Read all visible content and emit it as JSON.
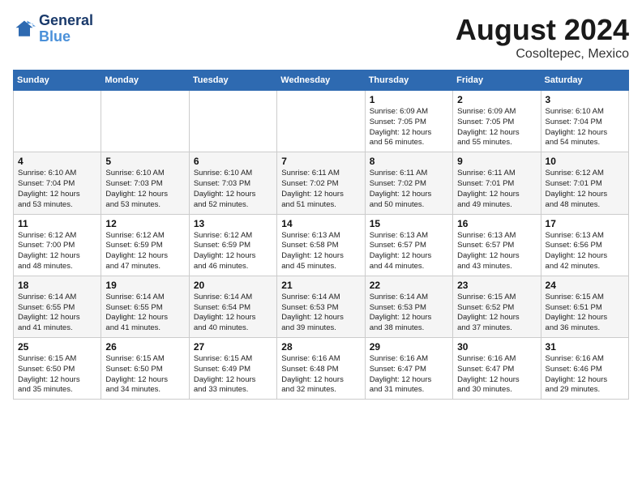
{
  "header": {
    "logo_line1": "General",
    "logo_line2": "Blue",
    "title": "August 2024",
    "subtitle": "Cosoltepec, Mexico"
  },
  "calendar": {
    "days_of_week": [
      "Sunday",
      "Monday",
      "Tuesday",
      "Wednesday",
      "Thursday",
      "Friday",
      "Saturday"
    ],
    "weeks": [
      {
        "days": [
          {
            "num": "",
            "info": ""
          },
          {
            "num": "",
            "info": ""
          },
          {
            "num": "",
            "info": ""
          },
          {
            "num": "",
            "info": ""
          },
          {
            "num": "1",
            "info": "Sunrise: 6:09 AM\nSunset: 7:05 PM\nDaylight: 12 hours\nand 56 minutes."
          },
          {
            "num": "2",
            "info": "Sunrise: 6:09 AM\nSunset: 7:05 PM\nDaylight: 12 hours\nand 55 minutes."
          },
          {
            "num": "3",
            "info": "Sunrise: 6:10 AM\nSunset: 7:04 PM\nDaylight: 12 hours\nand 54 minutes."
          }
        ]
      },
      {
        "days": [
          {
            "num": "4",
            "info": "Sunrise: 6:10 AM\nSunset: 7:04 PM\nDaylight: 12 hours\nand 53 minutes."
          },
          {
            "num": "5",
            "info": "Sunrise: 6:10 AM\nSunset: 7:03 PM\nDaylight: 12 hours\nand 53 minutes."
          },
          {
            "num": "6",
            "info": "Sunrise: 6:10 AM\nSunset: 7:03 PM\nDaylight: 12 hours\nand 52 minutes."
          },
          {
            "num": "7",
            "info": "Sunrise: 6:11 AM\nSunset: 7:02 PM\nDaylight: 12 hours\nand 51 minutes."
          },
          {
            "num": "8",
            "info": "Sunrise: 6:11 AM\nSunset: 7:02 PM\nDaylight: 12 hours\nand 50 minutes."
          },
          {
            "num": "9",
            "info": "Sunrise: 6:11 AM\nSunset: 7:01 PM\nDaylight: 12 hours\nand 49 minutes."
          },
          {
            "num": "10",
            "info": "Sunrise: 6:12 AM\nSunset: 7:01 PM\nDaylight: 12 hours\nand 48 minutes."
          }
        ]
      },
      {
        "days": [
          {
            "num": "11",
            "info": "Sunrise: 6:12 AM\nSunset: 7:00 PM\nDaylight: 12 hours\nand 48 minutes."
          },
          {
            "num": "12",
            "info": "Sunrise: 6:12 AM\nSunset: 6:59 PM\nDaylight: 12 hours\nand 47 minutes."
          },
          {
            "num": "13",
            "info": "Sunrise: 6:12 AM\nSunset: 6:59 PM\nDaylight: 12 hours\nand 46 minutes."
          },
          {
            "num": "14",
            "info": "Sunrise: 6:13 AM\nSunset: 6:58 PM\nDaylight: 12 hours\nand 45 minutes."
          },
          {
            "num": "15",
            "info": "Sunrise: 6:13 AM\nSunset: 6:57 PM\nDaylight: 12 hours\nand 44 minutes."
          },
          {
            "num": "16",
            "info": "Sunrise: 6:13 AM\nSunset: 6:57 PM\nDaylight: 12 hours\nand 43 minutes."
          },
          {
            "num": "17",
            "info": "Sunrise: 6:13 AM\nSunset: 6:56 PM\nDaylight: 12 hours\nand 42 minutes."
          }
        ]
      },
      {
        "days": [
          {
            "num": "18",
            "info": "Sunrise: 6:14 AM\nSunset: 6:55 PM\nDaylight: 12 hours\nand 41 minutes."
          },
          {
            "num": "19",
            "info": "Sunrise: 6:14 AM\nSunset: 6:55 PM\nDaylight: 12 hours\nand 41 minutes."
          },
          {
            "num": "20",
            "info": "Sunrise: 6:14 AM\nSunset: 6:54 PM\nDaylight: 12 hours\nand 40 minutes."
          },
          {
            "num": "21",
            "info": "Sunrise: 6:14 AM\nSunset: 6:53 PM\nDaylight: 12 hours\nand 39 minutes."
          },
          {
            "num": "22",
            "info": "Sunrise: 6:14 AM\nSunset: 6:53 PM\nDaylight: 12 hours\nand 38 minutes."
          },
          {
            "num": "23",
            "info": "Sunrise: 6:15 AM\nSunset: 6:52 PM\nDaylight: 12 hours\nand 37 minutes."
          },
          {
            "num": "24",
            "info": "Sunrise: 6:15 AM\nSunset: 6:51 PM\nDaylight: 12 hours\nand 36 minutes."
          }
        ]
      },
      {
        "days": [
          {
            "num": "25",
            "info": "Sunrise: 6:15 AM\nSunset: 6:50 PM\nDaylight: 12 hours\nand 35 minutes."
          },
          {
            "num": "26",
            "info": "Sunrise: 6:15 AM\nSunset: 6:50 PM\nDaylight: 12 hours\nand 34 minutes."
          },
          {
            "num": "27",
            "info": "Sunrise: 6:15 AM\nSunset: 6:49 PM\nDaylight: 12 hours\nand 33 minutes."
          },
          {
            "num": "28",
            "info": "Sunrise: 6:16 AM\nSunset: 6:48 PM\nDaylight: 12 hours\nand 32 minutes."
          },
          {
            "num": "29",
            "info": "Sunrise: 6:16 AM\nSunset: 6:47 PM\nDaylight: 12 hours\nand 31 minutes."
          },
          {
            "num": "30",
            "info": "Sunrise: 6:16 AM\nSunset: 6:47 PM\nDaylight: 12 hours\nand 30 minutes."
          },
          {
            "num": "31",
            "info": "Sunrise: 6:16 AM\nSunset: 6:46 PM\nDaylight: 12 hours\nand 29 minutes."
          }
        ]
      }
    ]
  }
}
